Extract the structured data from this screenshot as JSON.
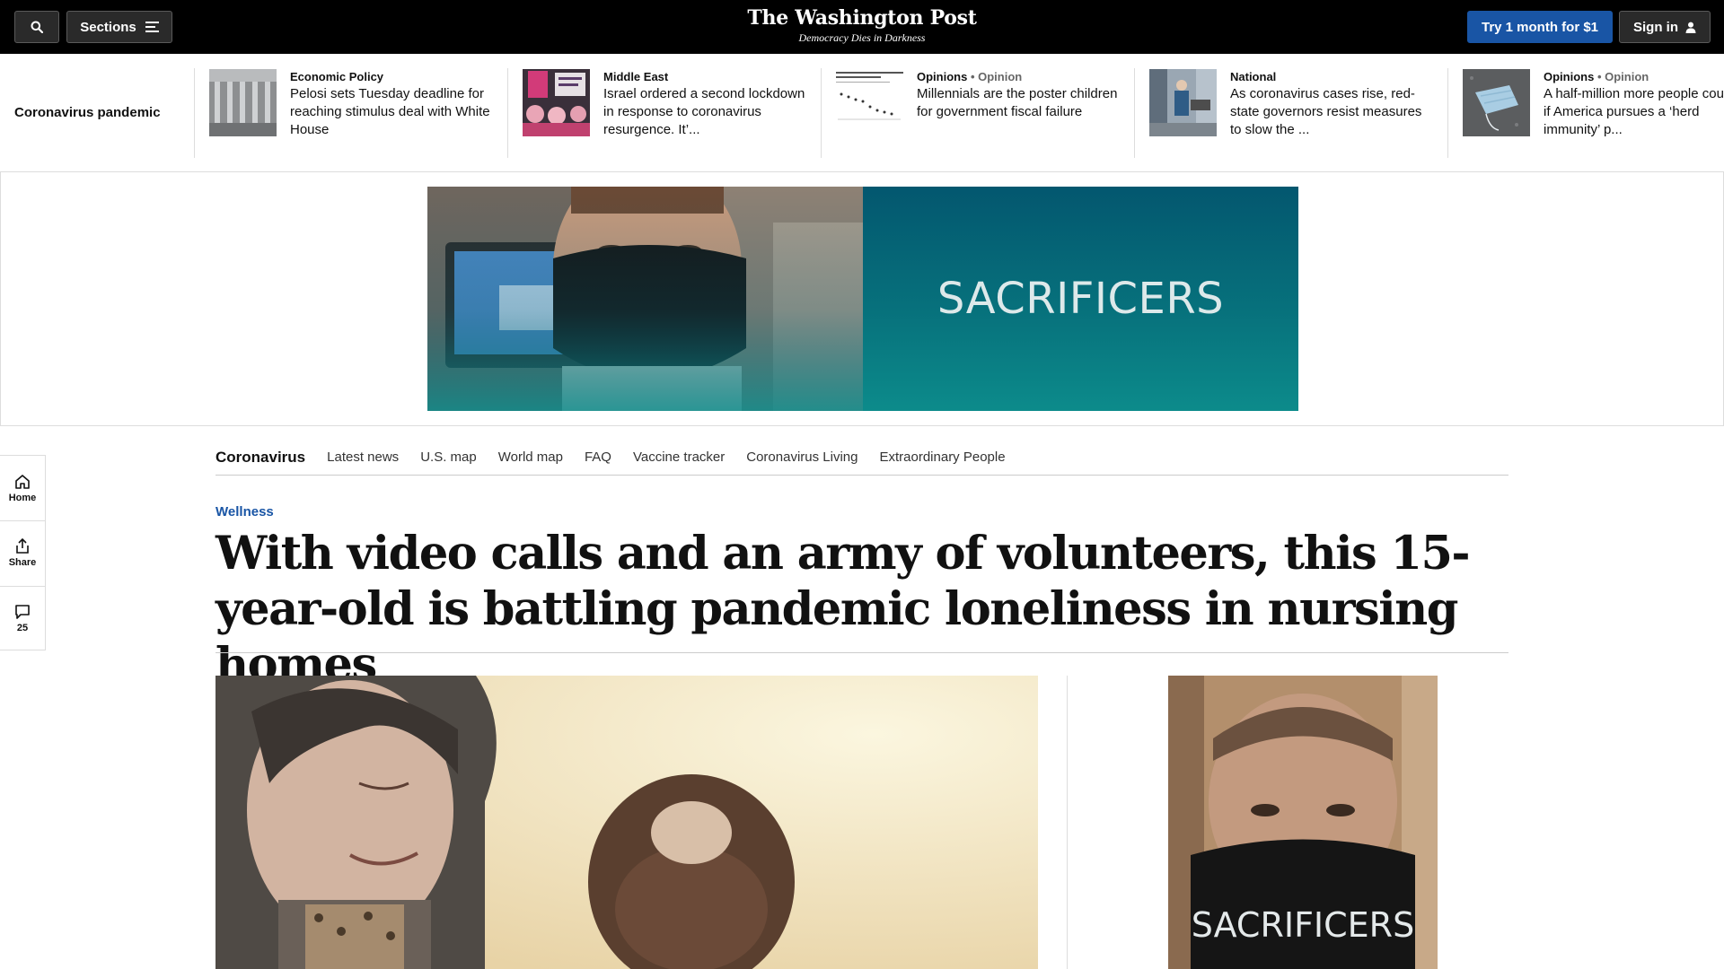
{
  "header": {
    "sections_label": "Sections",
    "logo": "The Washington Post",
    "tagline": "Democracy Dies in Darkness",
    "trial_button": "Try 1 month for $1",
    "signin_button": "Sign in"
  },
  "topic_strip": {
    "label": "Coronavirus pandemic",
    "items": [
      {
        "kicker": "Economic Policy",
        "kicker_suffix": "",
        "headline": "Pelosi sets Tuesday deadline for reaching stimulus deal with White House",
        "thumb": "building-photo"
      },
      {
        "kicker": "Middle East",
        "kicker_suffix": "",
        "headline": "Israel ordered a second lockdown in response to coronavirus resurgence. It’...",
        "thumb": "protest-photo"
      },
      {
        "kicker": "Opinions",
        "kicker_suffix": " • Opinion",
        "headline": "Millennials are the poster children for government fiscal failure",
        "thumb": "chart-thumbnail"
      },
      {
        "kicker": "National",
        "kicker_suffix": "",
        "headline": "As coronavirus cases rise, red-state governors resist measures to slow the ...",
        "thumb": "street-photo"
      },
      {
        "kicker": "Opinions",
        "kicker_suffix": " • Opinion",
        "headline": "A half-million more people cou die if America pursues a ‘herd immunity’ p...",
        "thumb": "mask-photo"
      }
    ]
  },
  "ad_banner": {
    "word": "SACRIFICERS",
    "colors": {
      "teal_top": "#03576f",
      "teal_bottom": "#0c8b8b"
    }
  },
  "rail": {
    "home_label": "Home",
    "share_label": "Share",
    "comments_count": "25"
  },
  "subnav": {
    "title": "Coronavirus",
    "links": [
      "Latest news",
      "U.S. map",
      "World map",
      "FAQ",
      "Vaccine tracker",
      "Coronavirus Living",
      "Extraordinary People"
    ]
  },
  "article": {
    "kicker": "Wellness",
    "headline": "With video calls and an army of volunteers, this 15-year-old is battling pandemic loneliness in nursing homes"
  },
  "side_ad": {
    "word": "SACRIFICERS"
  },
  "colors": {
    "brand_blue": "#1955a5",
    "topbar": "#000000"
  }
}
